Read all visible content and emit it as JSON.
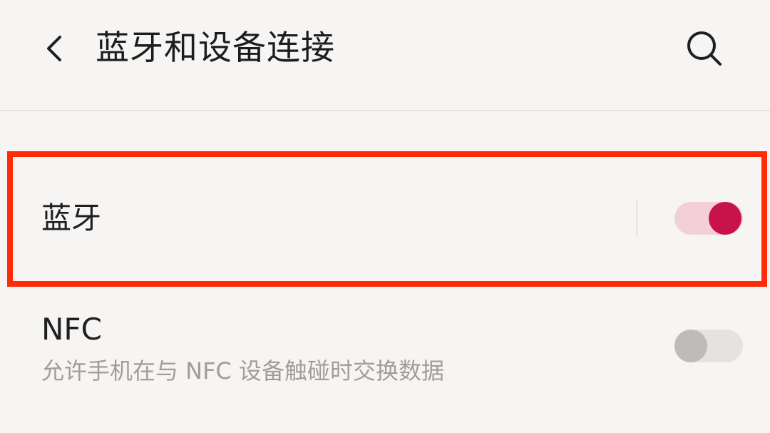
{
  "header": {
    "title": "蓝牙和设备连接",
    "back_icon": "chevron-left-icon",
    "search_icon": "search-icon"
  },
  "settings": {
    "bluetooth": {
      "label": "蓝牙",
      "enabled": true
    },
    "nfc": {
      "label": "NFC",
      "description": "允许手机在与 NFC 设备触碰时交换数据",
      "enabled": false
    }
  },
  "colors": {
    "highlight": "#ff2b08",
    "accent": "#c8124a",
    "accent_track": "#f3cfd9",
    "off_knob": "#bdbcbb",
    "off_track": "#e4e3e2"
  }
}
